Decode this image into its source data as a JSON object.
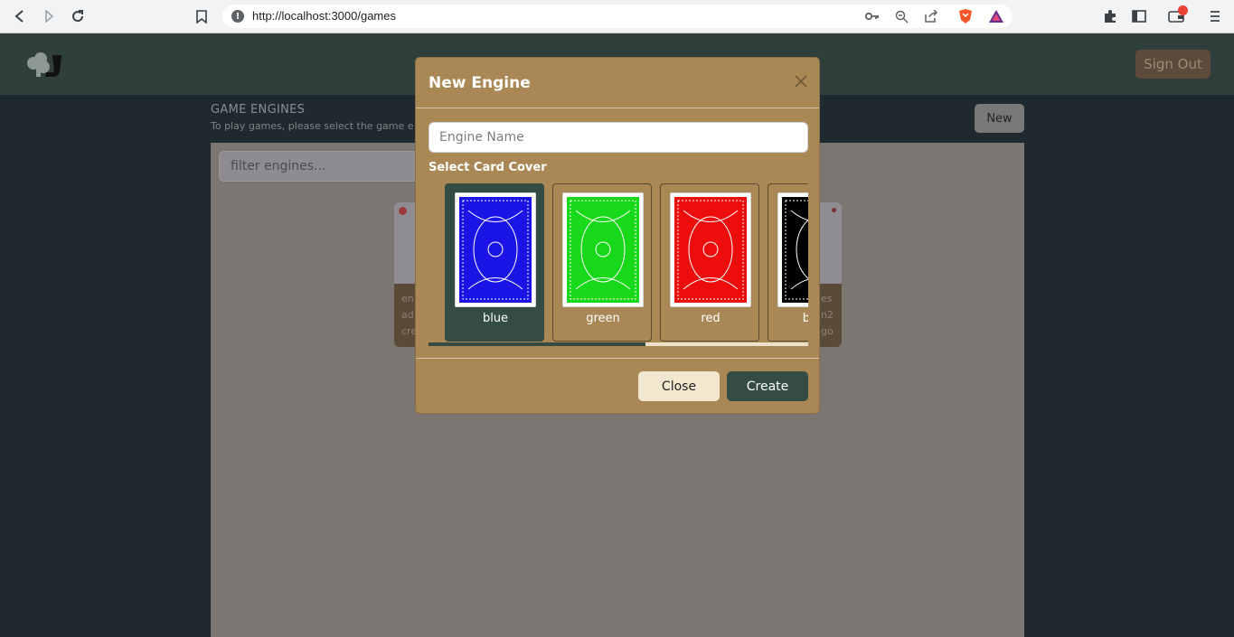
{
  "browser": {
    "url": "http://localhost:3000/games",
    "icons": [
      "back-icon",
      "forward-icon",
      "reload-icon",
      "bookmark-icon",
      "key-icon",
      "zoom-icon",
      "share-icon",
      "brave-shield-icon",
      "rewards-icon",
      "extensions-icon",
      "sidebar-icon",
      "wallet-icon",
      "menu-icon"
    ]
  },
  "header": {
    "signout_label": "Sign Out"
  },
  "page": {
    "title": "GAME ENGINES",
    "subtitle": "To play games, please select the game e",
    "new_label": "New",
    "filter_placeholder": "filter engines..."
  },
  "tile": {
    "left_lines": [
      "en",
      "ad",
      "cre"
    ],
    "right_lines": [
      "es",
      "n2",
      "go"
    ]
  },
  "modal": {
    "title": "New Engine",
    "name_placeholder": "Engine Name",
    "cover_label": "Select Card Cover",
    "covers": [
      {
        "label": "blue",
        "color": "#1a14e6",
        "selected": true
      },
      {
        "label": "green",
        "color": "#18d81a",
        "selected": false
      },
      {
        "label": "red",
        "color": "#ee0d0d",
        "selected": false
      },
      {
        "label": "black",
        "color": "#000000",
        "selected": false
      }
    ],
    "close_label": "Close",
    "create_label": "Create"
  },
  "colors": {
    "modal_bg": "#a98855",
    "accent_dark": "#344c44",
    "header_bg": "#2e3f3c"
  }
}
